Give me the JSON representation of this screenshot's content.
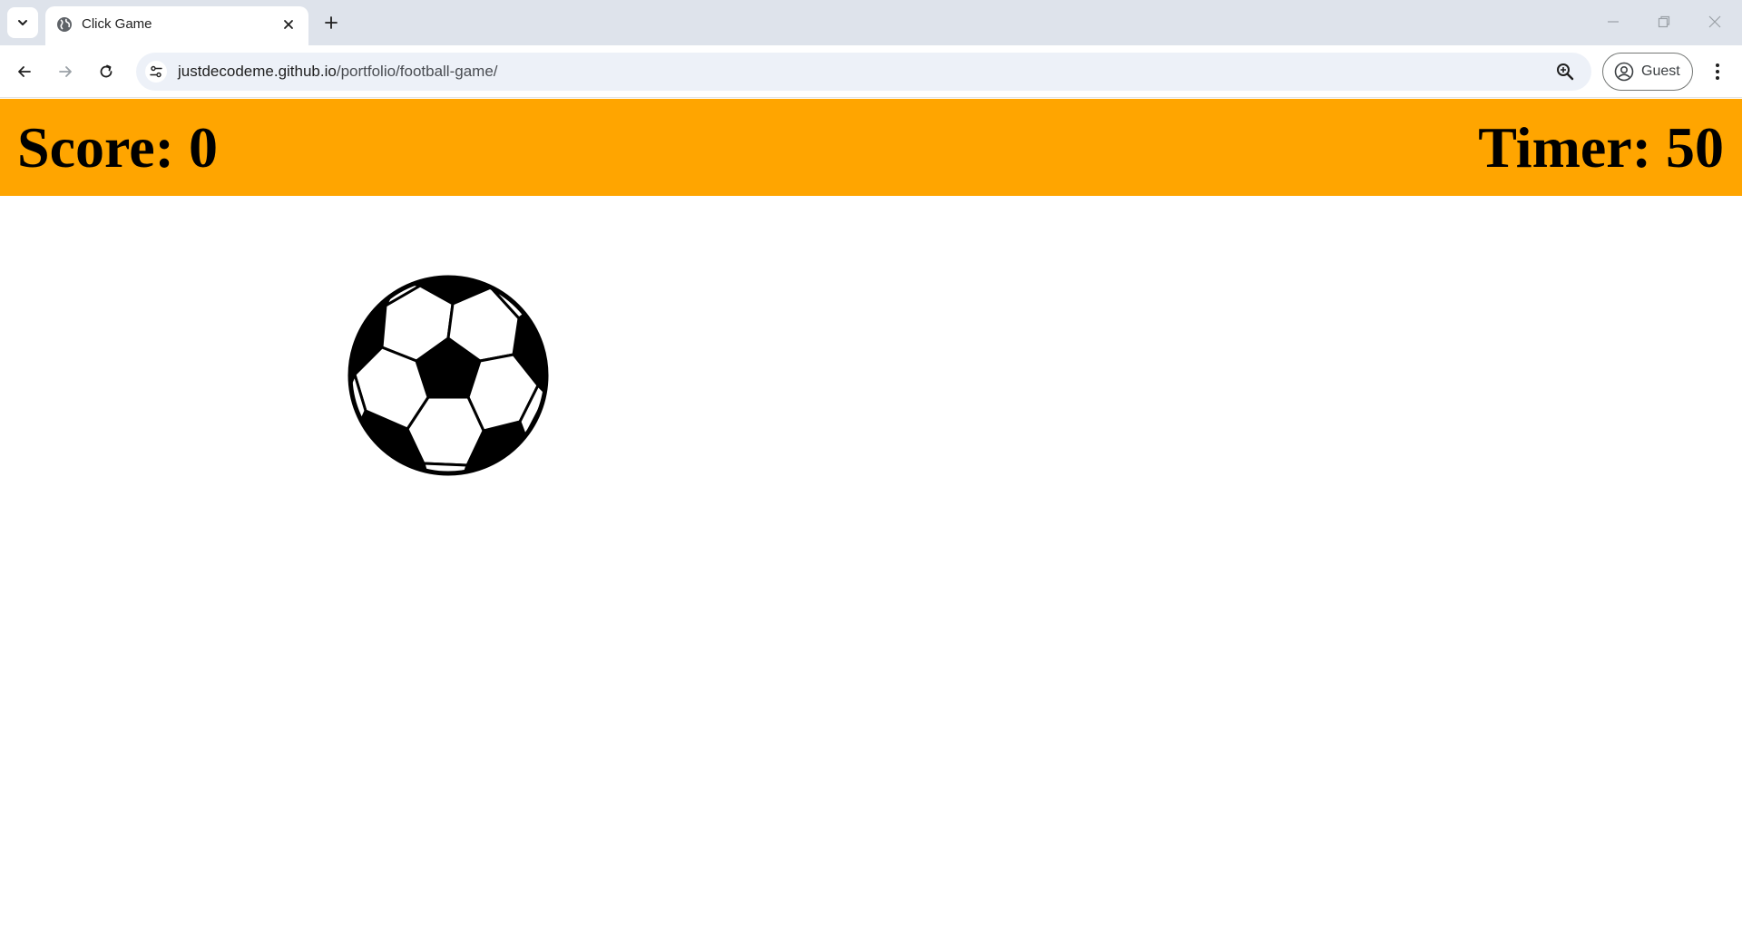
{
  "browser": {
    "tab_title": "Click Game",
    "url_host": "justdecodeme.github.io",
    "url_path": "/portfolio/football-game/",
    "profile_label": "Guest"
  },
  "game": {
    "score_text": "Score: 0",
    "timer_text": "Timer: 50",
    "score": 0,
    "timer": 50,
    "header_color": "#ffa500",
    "ball_icon": "soccer-ball-icon"
  }
}
